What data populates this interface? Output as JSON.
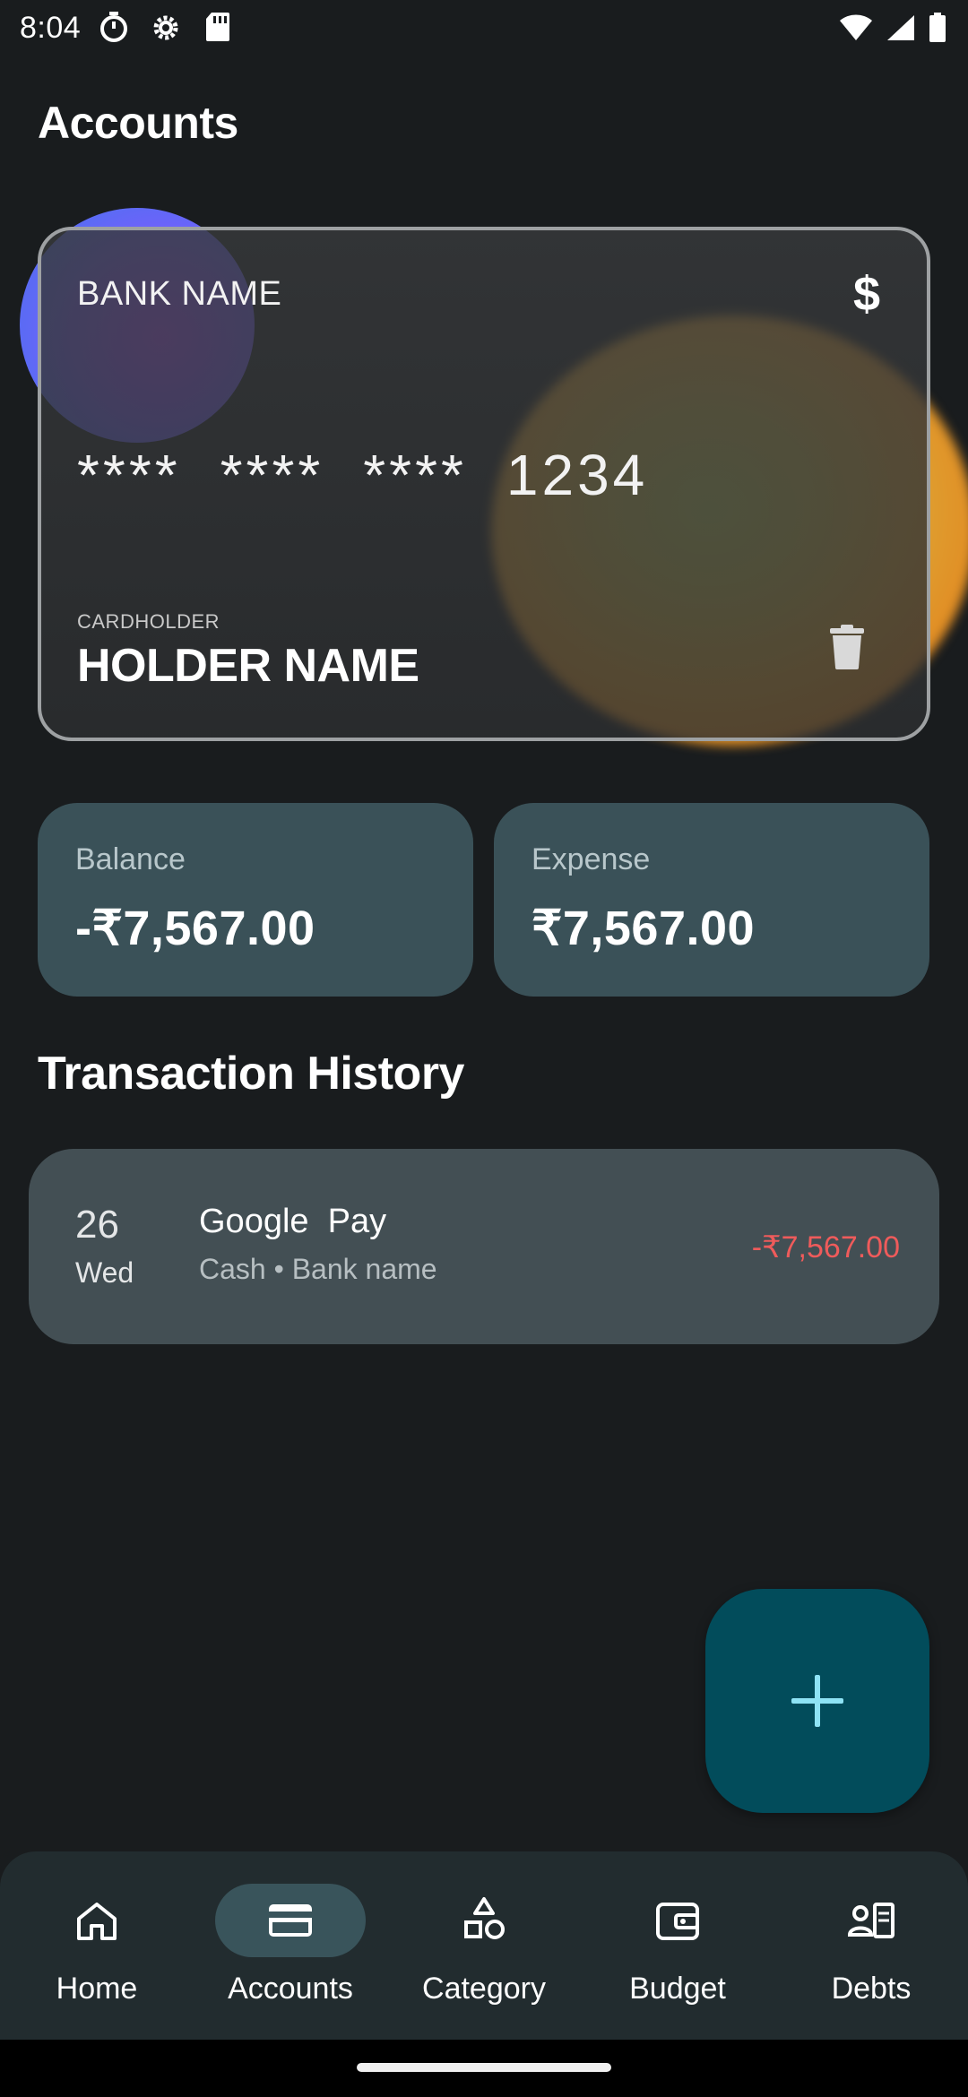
{
  "status_bar": {
    "time": "8:04"
  },
  "page": {
    "title": "Accounts"
  },
  "card": {
    "bank_name": "BANK NAME",
    "currency_symbol": "$",
    "number_groups": [
      "****",
      "****",
      "****",
      "1234"
    ],
    "holder_label": "CARDHOLDER",
    "holder_name": "HOLDER NAME"
  },
  "stats": {
    "balance_label": "Balance",
    "balance_value": "-₹7,567.00",
    "expense_label": "Expense",
    "expense_value": "₹7,567.00"
  },
  "transactions": {
    "section_title": "Transaction History",
    "items": [
      {
        "day": "26",
        "weekday": "Wed",
        "title": "Google  Pay",
        "subtitle": "Cash • Bank name",
        "amount": "-₹7,567.00"
      }
    ]
  },
  "nav": {
    "items": [
      {
        "label": "Home",
        "icon": "home-icon",
        "active": false
      },
      {
        "label": "Accounts",
        "icon": "credit-card-icon",
        "active": true
      },
      {
        "label": "Category",
        "icon": "shapes-icon",
        "active": false
      },
      {
        "label": "Budget",
        "icon": "wallet-icon",
        "active": false
      },
      {
        "label": "Debts",
        "icon": "contact-card-icon",
        "active": false
      }
    ]
  },
  "colors": {
    "background": "#191c1e",
    "tile": "#3a5158",
    "transaction_card": "#434f54",
    "fab": "#024c5b",
    "fab_icon": "#8ee3f5",
    "negative_amount": "#ef5b5b",
    "nav_active_pill": "#39545b"
  }
}
